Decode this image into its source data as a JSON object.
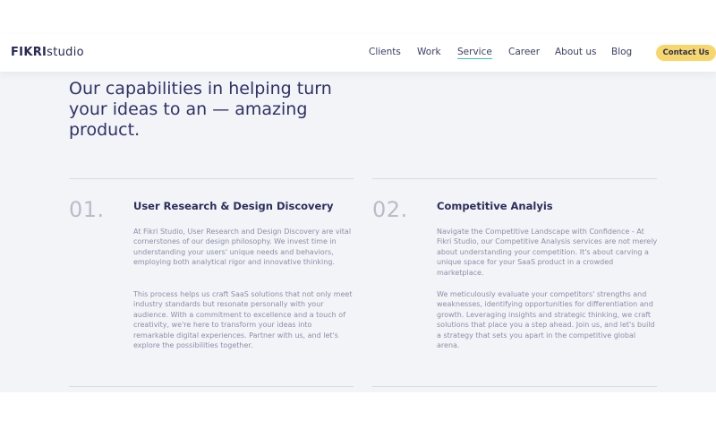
{
  "brand": {
    "logo_mark": "FIKRI",
    "logo_word": "studio"
  },
  "nav": {
    "items": [
      "Clients",
      "Work",
      "Service",
      "Career",
      "About us",
      "Blog"
    ],
    "active": "Service",
    "cta_label": "Contact Us"
  },
  "colors": {
    "accent": "#3fbfc8",
    "cta": "#f7d76b",
    "text": "#2b2f5a",
    "muted": "#8a8fa8"
  },
  "hero": {
    "title": "Our capabilities in helping turn your ideas to an — amazing product."
  },
  "services": [
    {
      "number": "01.",
      "title": "User Research & Design Discovery",
      "paragraphs": [
        "At Fikri Studio, User Research and Design Discovery are vital cornerstones of our design philosophy. We invest time in understanding your users' unique needs and behaviors, employing both analytical rigor and innovative thinking.",
        "This process helps us craft SaaS solutions that not only meet industry standards but resonate personally with your audience. With a commitment to excellence and a touch of creativity, we're here to transform your ideas into remarkable digital experiences. Partner with us, and let's explore the possibilities together."
      ]
    },
    {
      "number": "02.",
      "title": "Competitive Analyis",
      "paragraphs": [
        "Navigate the Competitive Landscape with Confidence - At Fikri Studio, our Competitive Analysis services are not merely about understanding your competition. It's about carving a unique space for your SaaS product in a crowded marketplace.",
        "We meticulously evaluate your competitors' strengths and weaknesses, identifying opportunities for differentiation and growth. Leveraging insights and strategic thinking, we craft solutions that place you a step ahead. Join us, and let's build a strategy that sets you apart in the competitive global arena."
      ]
    }
  ]
}
